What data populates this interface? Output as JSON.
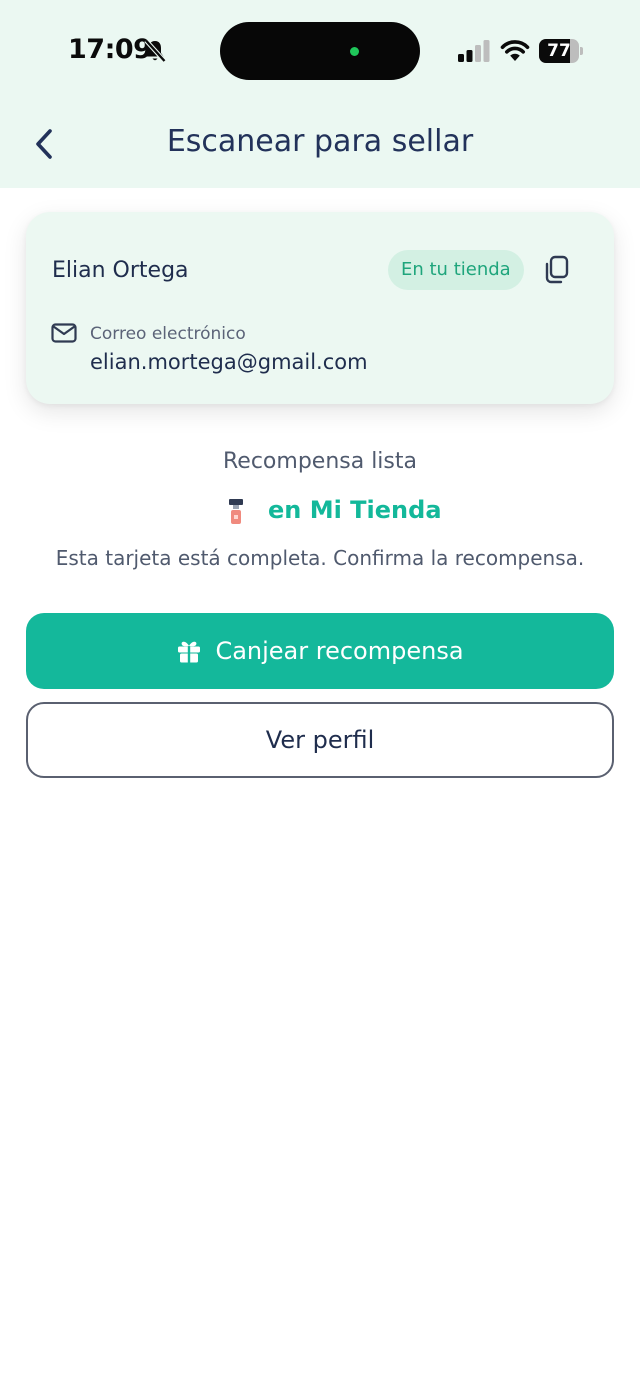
{
  "status_bar": {
    "time": "17:09",
    "battery_level": "77",
    "battery_fraction": 0.77,
    "icons": [
      "bell-muted-icon",
      "cellular-signal-icon",
      "wifi-icon",
      "battery-icon"
    ]
  },
  "header": {
    "title": "Escanear para sellar",
    "back_icon": "chevron-left-icon"
  },
  "customer_card": {
    "name": "Elian Ortega",
    "badge": "En tu tienda",
    "copy_icon": "copy-icon",
    "email_label": "Correo electrónico",
    "email": "elian.mortega@gmail.com",
    "email_icon": "envelope-icon"
  },
  "reward": {
    "status": "Recompensa lista",
    "store_name": "en Mi Tienda",
    "description": "Esta tarjeta está completa. Confirma la recompensa.",
    "icon": "perfume-bottle-icon"
  },
  "actions": {
    "redeem_label": "Canjear recompensa",
    "redeem_icon": "gift-icon",
    "profile_label": "Ver perfil"
  },
  "colors": {
    "accent": "#14b89b",
    "header_bg": "#ebf8f2",
    "card_bg": "#ecf8f2",
    "badge_bg": "#d3f0e3",
    "badge_text": "#1fa57c",
    "text_primary": "#1f2d4d"
  }
}
